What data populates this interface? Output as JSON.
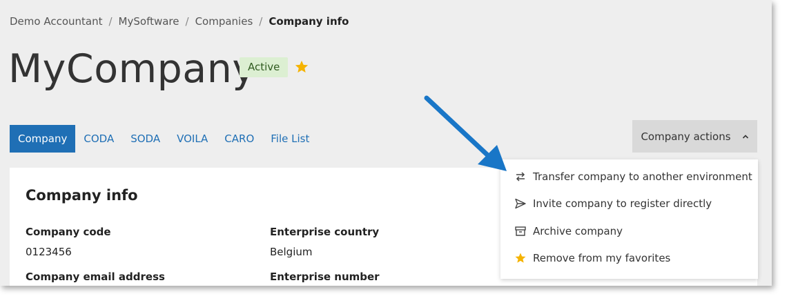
{
  "breadcrumb": {
    "items": [
      "Demo Accountant",
      "MySoftware",
      "Companies"
    ],
    "current": "Company info",
    "separator": "/"
  },
  "header": {
    "title": "MyCompany",
    "status_badge": "Active",
    "favorite_icon": "star-icon"
  },
  "tabs": [
    {
      "label": "Company",
      "active": true
    },
    {
      "label": "CODA",
      "active": false
    },
    {
      "label": "SODA",
      "active": false
    },
    {
      "label": "VOILA",
      "active": false
    },
    {
      "label": "CARO",
      "active": false
    },
    {
      "label": "File List",
      "active": false
    }
  ],
  "actions": {
    "button_label": "Company actions",
    "expanded_icon": "chevron-up-icon",
    "menu": [
      {
        "label": "Transfer company to another environment",
        "icon": "transfer-arrows-icon"
      },
      {
        "label": "Invite company to register directly",
        "icon": "send-icon"
      },
      {
        "label": "Archive company",
        "icon": "archive-icon"
      },
      {
        "label": "Remove from my favorites",
        "icon": "star-icon"
      }
    ]
  },
  "company_info": {
    "title": "Company info",
    "fields": {
      "company_code": {
        "label": "Company code",
        "value": "0123456"
      },
      "enterprise_country": {
        "label": "Enterprise country",
        "value": "Belgium"
      },
      "company_email": {
        "label": "Company email address",
        "value": ""
      },
      "enterprise_number": {
        "label": "Enterprise number",
        "value": ""
      }
    }
  },
  "colors": {
    "accent": "#1f6fb5",
    "badge_bg": "#dcefd2",
    "star": "#f5b301",
    "callout_arrow": "#1976c7"
  }
}
